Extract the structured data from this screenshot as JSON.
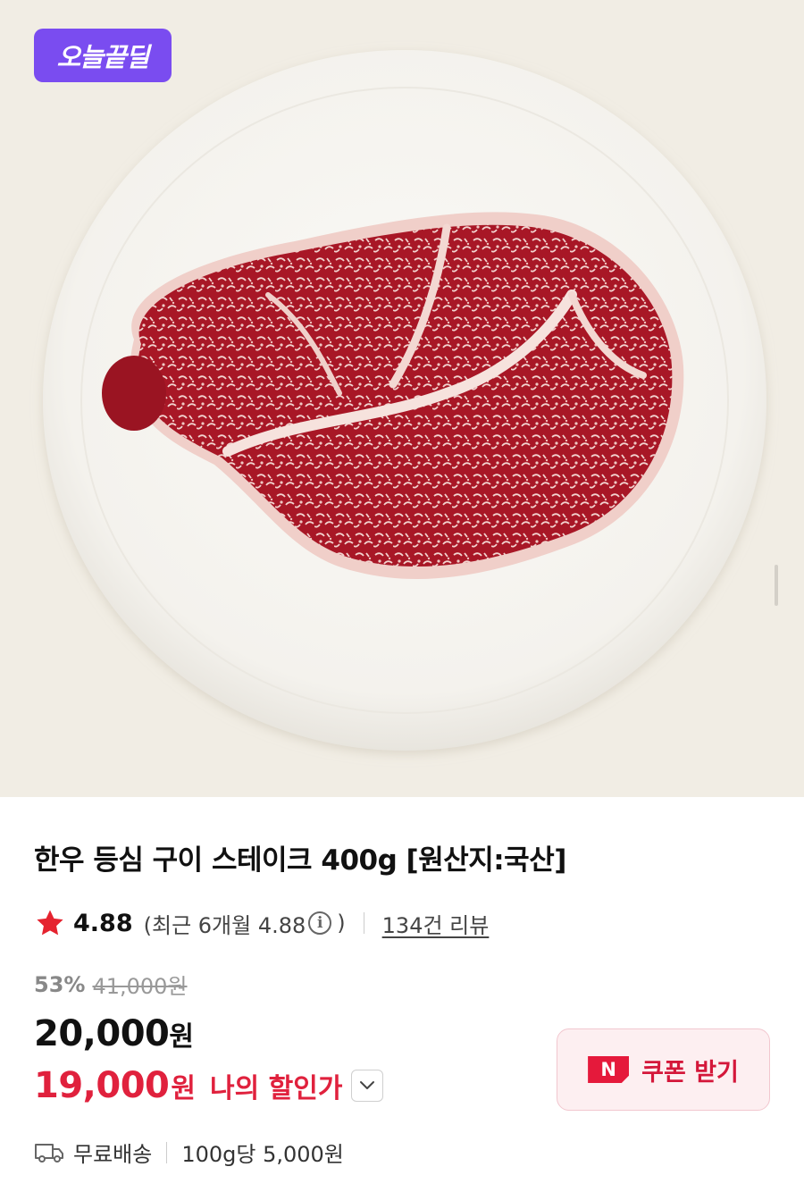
{
  "hero": {
    "badge_label": "오늘끝딜",
    "image_alt": "한우 등심 구이 스테이크"
  },
  "product": {
    "title": "한우 등심 구이 스테이크 400g [원산지:국산]",
    "rating": "4.88",
    "recent_rating_prefix": "(최근 6개월 4.88",
    "recent_rating_suffix": ")",
    "review_count": "134건 리뷰",
    "discount_rate": "53%",
    "original_price": "41,000원",
    "price": "20,000",
    "price_unit": "원",
    "my_price": "19,000",
    "my_price_unit": "원",
    "my_price_label": "나의 할인가",
    "coupon_label": "쿠폰 받기",
    "coupon_icon_letter": "N",
    "delivery": "무료배송",
    "unit_price": "100g당 5,000원"
  },
  "colors": {
    "badge": "#7a4cf0",
    "accent_red": "#e0213d",
    "star": "#e5232f",
    "coupon_bg": "#fdeff1"
  },
  "icons": [
    "star-icon",
    "info-icon",
    "chevron-down-icon",
    "naver-icon",
    "truck-icon"
  ]
}
